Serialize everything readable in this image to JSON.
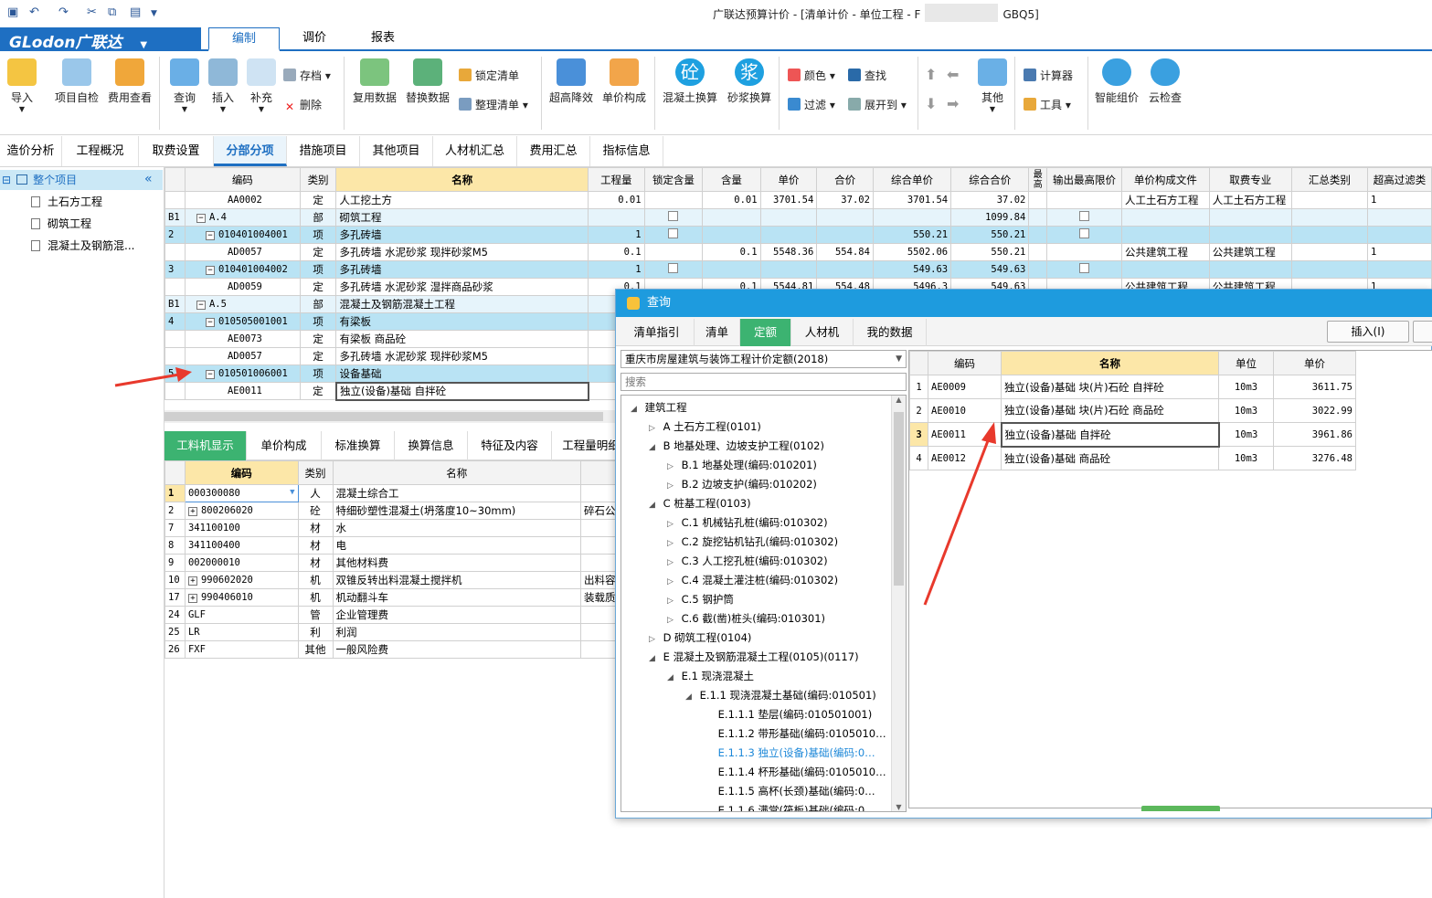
{
  "window": {
    "title": "广联达预算计价 - [清单计价 - 单位工程 - F",
    "title_suffix": "GBQ5]"
  },
  "logo": {
    "text": "GLodon广联达"
  },
  "menu": [
    "编制",
    "调价",
    "报表"
  ],
  "ribbon": {
    "big_buttons": [
      "导入",
      "项目自检",
      "费用查看",
      "查询",
      "插入",
      "补充",
      "复用数据",
      "替换数据",
      "超高降效",
      "单价构成",
      "混凝土换算",
      "砂浆换算",
      "其他",
      "智能组价",
      "云检查"
    ],
    "small_buttons": [
      "存档",
      "删除",
      "锁定清单",
      "整理清单",
      "颜色",
      "查找",
      "过滤",
      "展开到",
      "计算器",
      "工具"
    ],
    "glyphs": {
      "concrete": "砼",
      "mortar": "浆"
    }
  },
  "nav_tabs": [
    "造价分析",
    "工程概况",
    "取费设置",
    "分部分项",
    "措施项目",
    "其他项目",
    "人材机汇总",
    "费用汇总",
    "指标信息"
  ],
  "left_tree": {
    "root": "整个项目",
    "items": [
      "土石方工程",
      "砌筑工程",
      "混凝土及钢筋混..."
    ]
  },
  "main_grid": {
    "headers": [
      "编码",
      "类别",
      "名称",
      "工程量",
      "锁定含量",
      "含量",
      "单价",
      "合价",
      "综合单价",
      "综合合价",
      "最高",
      "输出最高限价",
      "单价构成文件",
      "取费专业",
      "汇总类别",
      "超高过滤类"
    ],
    "rows": [
      {
        "seq": "",
        "code": "AA0002",
        "type": "定",
        "name": "人工挖土方",
        "qty": "0.01",
        "lock": "",
        "content": "0.01",
        "price": "3701.54",
        "total": "37.02",
        "uprice": "3701.54",
        "utotal": "37.02",
        "file": "人工土石方工程",
        "prof": "人工土石方工程",
        "over": "1",
        "style": "plain"
      },
      {
        "seq": "B1",
        "code": "A.4",
        "type": "部",
        "name": "砌筑工程",
        "qty": "",
        "lock": "",
        "content": "",
        "price": "",
        "total": "",
        "uprice": "",
        "utotal": "1099.84",
        "file": "",
        "prof": "",
        "over": "",
        "style": "lblue"
      },
      {
        "seq": "2",
        "code": "010401004001",
        "type": "项",
        "name": "多孔砖墙",
        "qty": "1",
        "lock": "",
        "content": "",
        "price": "",
        "total": "",
        "uprice": "550.21",
        "utotal": "550.21",
        "file": "",
        "prof": "",
        "over": "",
        "style": "blue"
      },
      {
        "seq": "",
        "code": "AD0057",
        "type": "定",
        "name": "多孔砖墙 水泥砂浆 现拌砂浆M5",
        "qty": "0.1",
        "lock": "",
        "content": "0.1",
        "price": "5548.36",
        "total": "554.84",
        "uprice": "5502.06",
        "utotal": "550.21",
        "file": "公共建筑工程",
        "prof": "公共建筑工程",
        "over": "1",
        "style": "plain"
      },
      {
        "seq": "3",
        "code": "010401004002",
        "type": "项",
        "name": "多孔砖墙",
        "qty": "1",
        "lock": "",
        "content": "",
        "price": "",
        "total": "",
        "uprice": "549.63",
        "utotal": "549.63",
        "file": "",
        "prof": "",
        "over": "",
        "style": "blue"
      },
      {
        "seq": "",
        "code": "AD0059",
        "type": "定",
        "name": "多孔砖墙 水泥砂浆 湿拌商品砂浆",
        "qty": "0.1",
        "lock": "",
        "content": "0.1",
        "price": "5544.81",
        "total": "554.48",
        "uprice": "5496.3",
        "utotal": "549.63",
        "file": "公共建筑工程",
        "prof": "公共建筑工程",
        "over": "1",
        "style": "plain"
      },
      {
        "seq": "B1",
        "code": "A.5",
        "type": "部",
        "name": "混凝土及钢筋混凝土工程",
        "qty": "",
        "lock": "",
        "content": "",
        "price": "",
        "total": "",
        "uprice": "",
        "utotal": "",
        "file": "",
        "prof": "",
        "over": "",
        "style": "lblue"
      },
      {
        "seq": "4",
        "code": "010505001001",
        "type": "项",
        "name": "有梁板",
        "qty": "",
        "lock": "",
        "content": "",
        "price": "",
        "total": "",
        "uprice": "",
        "utotal": "",
        "file": "",
        "prof": "",
        "over": "",
        "style": "blue"
      },
      {
        "seq": "",
        "code": "AE0073",
        "type": "定",
        "name": "有梁板 商品砼",
        "qty": "",
        "lock": "",
        "content": "",
        "price": "",
        "total": "",
        "uprice": "",
        "utotal": "",
        "file": "",
        "prof": "",
        "over": "",
        "style": "plain"
      },
      {
        "seq": "",
        "code": "AD0057",
        "type": "定",
        "name": "多孔砖墙 水泥砂浆 现拌砂浆M5",
        "qty": "",
        "lock": "",
        "content": "",
        "price": "",
        "total": "",
        "uprice": "",
        "utotal": "",
        "file": "",
        "prof": "",
        "over": "",
        "style": "plain"
      },
      {
        "seq": "5",
        "code": "010501006001",
        "type": "项",
        "name": "设备基础",
        "qty": "",
        "lock": "",
        "content": "",
        "price": "",
        "total": "",
        "uprice": "",
        "utotal": "",
        "file": "",
        "prof": "",
        "over": "",
        "style": "blue"
      },
      {
        "seq": "",
        "code": "AE0011",
        "type": "定",
        "name": "独立(设备)基础 自拌砼",
        "qty": "",
        "lock": "",
        "content": "",
        "price": "",
        "total": "",
        "uprice": "",
        "utotal": "",
        "file": "",
        "prof": "",
        "over": "",
        "style": "plain"
      }
    ]
  },
  "bottom_tabs": [
    "工料机显示",
    "单价构成",
    "标准换算",
    "换算信息",
    "特征及内容",
    "工程量明细"
  ],
  "bottom_grid": {
    "headers": [
      "编码",
      "类别",
      "名称"
    ],
    "rows": [
      {
        "seq": "1",
        "code": "000300080",
        "type": "人",
        "name": "混凝土综合工",
        "extra": ""
      },
      {
        "seq": "2",
        "code": "800206020",
        "type": "砼",
        "name": "特细砂塑性混凝土(坍落度10~30mm)",
        "extra": "碎石公"
      },
      {
        "seq": "7",
        "code": "341100100",
        "type": "材",
        "name": "水",
        "extra": ""
      },
      {
        "seq": "8",
        "code": "341100400",
        "type": "材",
        "name": "电",
        "extra": ""
      },
      {
        "seq": "9",
        "code": "002000010",
        "type": "材",
        "name": "其他材料费",
        "extra": ""
      },
      {
        "seq": "10",
        "code": "990602020",
        "type": "机",
        "name": "双锥反转出料混凝土搅拌机",
        "extra": "出料容"
      },
      {
        "seq": "17",
        "code": "990406010",
        "type": "机",
        "name": "机动翻斗车",
        "extra": "装载质"
      },
      {
        "seq": "24",
        "code": "GLF",
        "type": "管",
        "name": "企业管理费",
        "extra": ""
      },
      {
        "seq": "25",
        "code": "LR",
        "type": "利",
        "name": "利润",
        "extra": ""
      },
      {
        "seq": "26",
        "code": "FXF",
        "type": "其他",
        "name": "一般风险费",
        "extra": ""
      }
    ]
  },
  "dialog": {
    "title": "查询",
    "tabs": [
      "清单指引",
      "清单",
      "定额",
      "人材机",
      "我的数据"
    ],
    "insert_button": "插入(I)",
    "quota_library": "重庆市房屋建筑与装饰工程计价定额(2018)",
    "search_placeholder": "搜索",
    "tree": [
      "建筑工程",
      "A 土石方工程(0101)",
      "B 地基处理、边坡支护工程(0102)",
      "B.1 地基处理(编码:010201)",
      "B.2 边坡支护(编码:010202)",
      "C 桩基工程(0103)",
      "C.1 机械钻孔桩(编码:010302)",
      "C.2 旋挖钻机钻孔(编码:010302)",
      "C.3 人工挖孔桩(编码:010302)",
      "C.4 混凝土灌注桩(编码:010302)",
      "C.5 钢护筒",
      "C.6 截(凿)桩头(编码:010301)",
      "D 砌筑工程(0104)",
      "E 混凝土及钢筋混凝土工程(0105)(0117)",
      "E.1 现浇混凝土",
      "E.1.1 现浇混凝土基础(编码:010501)",
      "E.1.1.1 垫层(编码:010501001)",
      "E.1.1.2 带形基础(编码:0105010…",
      "E.1.1.3 独立(设备)基础(编码:0…",
      "E.1.1.4 杯形基础(编码:0105010…",
      "E.1.1.5 高杯(长颈)基础(编码:0…",
      "E.1.1.6 满堂(筏板)基础(编码:0…"
    ],
    "grid_headers": [
      "编码",
      "名称",
      "单位",
      "单价"
    ],
    "grid_rows": [
      {
        "seq": "1",
        "code": "AE0009",
        "name": "独立(设备)基础 块(片)石砼 自拌砼",
        "unit": "10m3",
        "price": "3611.75"
      },
      {
        "seq": "2",
        "code": "AE0010",
        "name": "独立(设备)基础 块(片)石砼 商品砼",
        "unit": "10m3",
        "price": "3022.99"
      },
      {
        "seq": "3",
        "code": "AE0011",
        "name": "独立(设备)基础 自拌砼",
        "unit": "10m3",
        "price": "3961.86"
      },
      {
        "seq": "4",
        "code": "AE0012",
        "name": "独立(设备)基础 商品砼",
        "unit": "10m3",
        "price": "3276.48"
      }
    ]
  },
  "colors": {
    "brand": "#1e6fc2",
    "green_tab": "#3cb371",
    "row_blue": "#b9e3f4",
    "arrow": "#e8392c"
  }
}
